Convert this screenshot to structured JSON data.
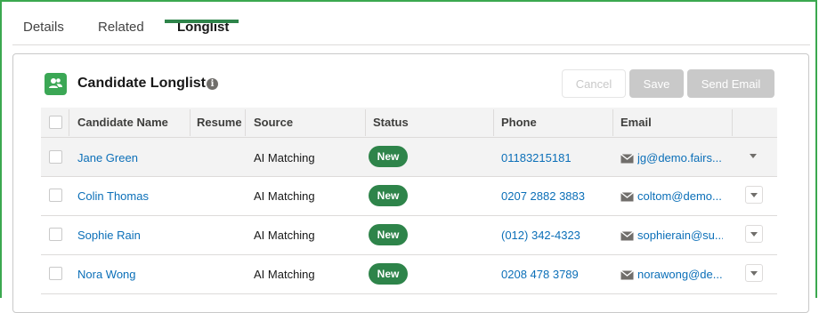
{
  "tabs": [
    {
      "label": "Details",
      "active": false
    },
    {
      "label": "Related",
      "active": false
    },
    {
      "label": "Longlist",
      "active": true
    }
  ],
  "card": {
    "title": "Candidate Longlist",
    "icon": "people-icon",
    "info_icon": "info-icon",
    "buttons": {
      "cancel": "Cancel",
      "save": "Save",
      "send_email": "Send Email"
    }
  },
  "table": {
    "columns": [
      "Candidate Name",
      "Resume",
      "Source",
      "Status",
      "Phone",
      "Email"
    ],
    "rows": [
      {
        "name": "Jane Green",
        "resume": "",
        "source": "AI Matching",
        "status": "New",
        "phone": "01183215181",
        "email": "jg@demo.fairs..."
      },
      {
        "name": "Colin Thomas",
        "resume": "",
        "source": "AI Matching",
        "status": "New",
        "phone": "0207 2882 3883",
        "email": "coltom@demo..."
      },
      {
        "name": "Sophie Rain",
        "resume": "",
        "source": "AI Matching",
        "status": "New",
        "phone": "(012) 342-4323",
        "email": "sophierain@su..."
      },
      {
        "name": "Nora Wong",
        "resume": "",
        "source": "AI Matching",
        "status": "New",
        "phone": "0208 478 3789",
        "email": "norawong@de..."
      }
    ]
  },
  "colors": {
    "accent": "#2e844a",
    "link": "#0b6fb8",
    "frame": "#3ba84f",
    "icon_bg": "#3ba755"
  }
}
